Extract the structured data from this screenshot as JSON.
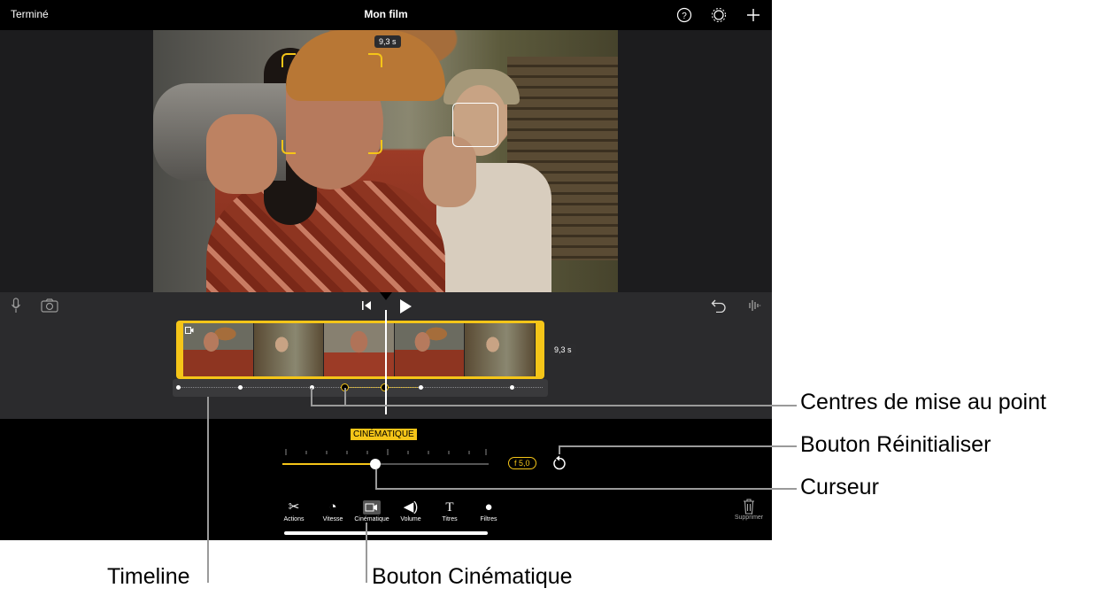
{
  "topbar": {
    "done": "Terminé",
    "title": "Mon film"
  },
  "viewer": {
    "duration_badge": "9,3 s"
  },
  "clip": {
    "duration_badge": "9,3 s"
  },
  "mode_label": "CINÉMATIQUE",
  "aperture": {
    "value": "f 5,0",
    "slider_fraction": 0.45
  },
  "toolbar": {
    "items": [
      {
        "label": "Actions",
        "icon": "scissors-icon"
      },
      {
        "label": "Vitesse",
        "icon": "speedometer-icon"
      },
      {
        "label": "Cinématique",
        "icon": "cinematic-camera-icon"
      },
      {
        "label": "Volume",
        "icon": "speaker-icon"
      },
      {
        "label": "Titres",
        "icon": "title-t-icon"
      },
      {
        "label": "Filtres",
        "icon": "filters-icon"
      }
    ],
    "delete_label": "Supprimer"
  },
  "callouts": {
    "focus_points": "Centres de mise au point",
    "reset_button": "Bouton Réinitialiser",
    "slider": "Curseur",
    "timeline": "Timeline",
    "cinematic_button": "Bouton Cinématique"
  },
  "colors": {
    "accent": "#f5c518",
    "background": "#000000",
    "panel": "#2b2b2d"
  }
}
